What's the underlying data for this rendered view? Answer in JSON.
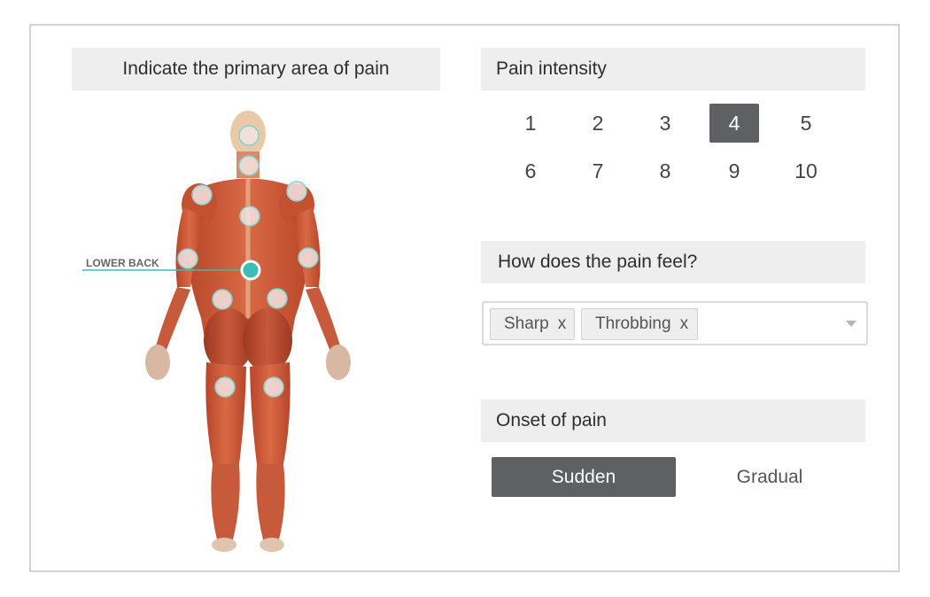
{
  "area": {
    "heading": "Indicate the primary area of pain",
    "selected_label": "LOWER BACK",
    "accent_color": "#3cbcb7"
  },
  "intensity": {
    "heading": "Pain intensity",
    "values": [
      "1",
      "2",
      "3",
      "4",
      "5",
      "6",
      "7",
      "8",
      "9",
      "10"
    ],
    "selected": "4"
  },
  "feel": {
    "heading": "How does the pain feel?",
    "tags": [
      {
        "label": "Sharp",
        "remove": "x"
      },
      {
        "label": "Throbbing",
        "remove": "x"
      }
    ]
  },
  "onset": {
    "heading": "Onset of pain",
    "options": [
      "Sudden",
      "Gradual"
    ],
    "selected": "Sudden"
  }
}
